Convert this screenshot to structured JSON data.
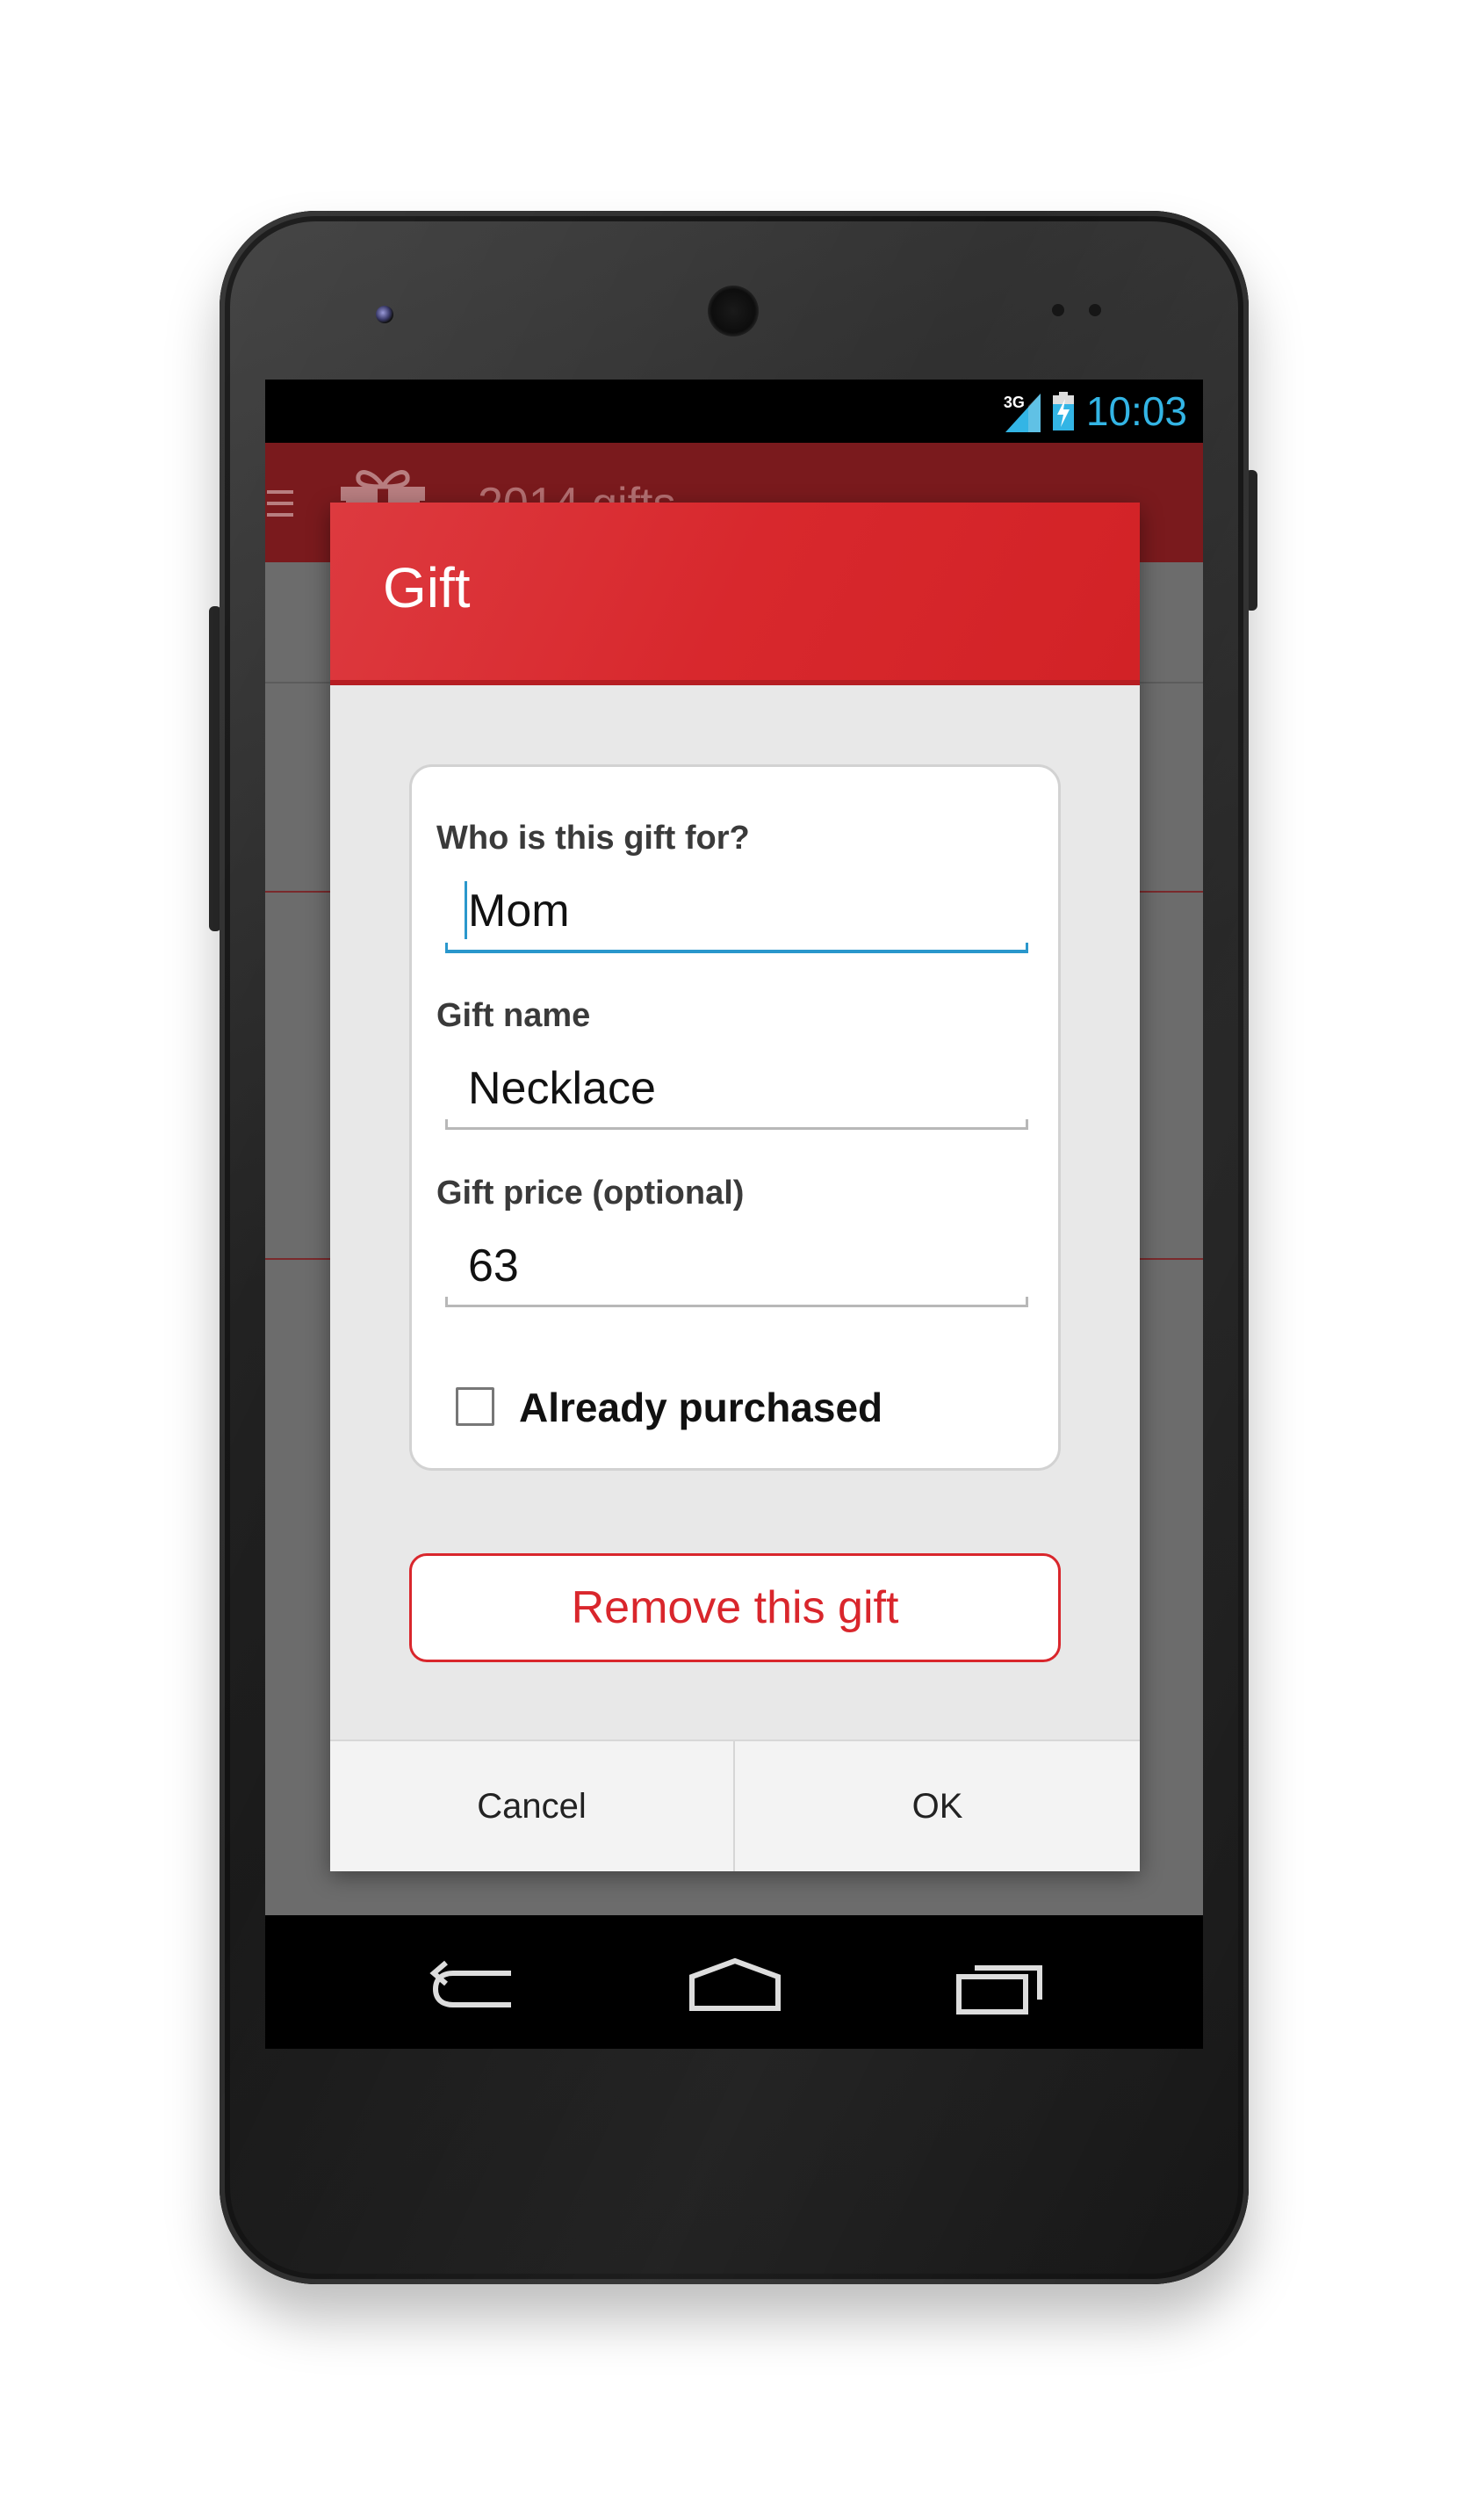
{
  "status_bar": {
    "network": "3G",
    "time": "10:03",
    "signal_icon": "signal-icon",
    "battery_icon": "battery-charging-icon"
  },
  "app_bar": {
    "title": "2014 gifts",
    "menu_icon": "menu-icon",
    "gift_icon": "gift-icon"
  },
  "dialog": {
    "title": "Gift",
    "fields": [
      {
        "label": "Who is this gift for?",
        "value": "Mom"
      },
      {
        "label": "Gift name",
        "value": "Necklace"
      },
      {
        "label": "Gift price (optional)",
        "value": "63"
      }
    ],
    "checkbox": {
      "label": "Already purchased",
      "checked": false
    },
    "remove_button": "Remove this gift",
    "cancel_button": "Cancel",
    "ok_button": "OK"
  },
  "nav_bar": {
    "back_icon": "back-icon",
    "home_icon": "home-icon",
    "recents_icon": "recents-icon"
  },
  "colors": {
    "accent": "#d9262c",
    "status_time": "#33b5e5",
    "focus_line": "#2a97cc"
  }
}
